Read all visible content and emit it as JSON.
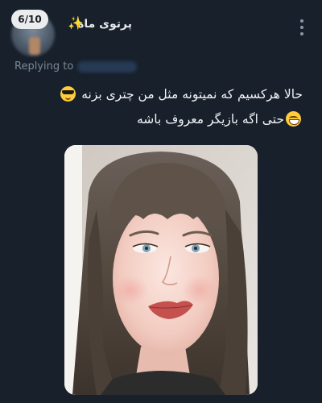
{
  "header": {
    "counter": "6/10",
    "author_name": "پرتوی ماه",
    "sparkle": "✨"
  },
  "reply": {
    "label": "Replying to"
  },
  "tweet": {
    "line1": "حالا هرکسیم که نمیتونه مثل من چتری بزنه",
    "line2": "حتی اگه بازیگر معروف باشه"
  },
  "icons": {
    "more": "more-icon",
    "line1_emoji": "smiling-face-with-sunglasses",
    "line2_emoji": "grinning-face-with-smiling-eyes"
  },
  "colors": {
    "background": "#17202b",
    "text": "#e7e9ea",
    "muted": "#7b8894",
    "handle": "#263a55"
  }
}
